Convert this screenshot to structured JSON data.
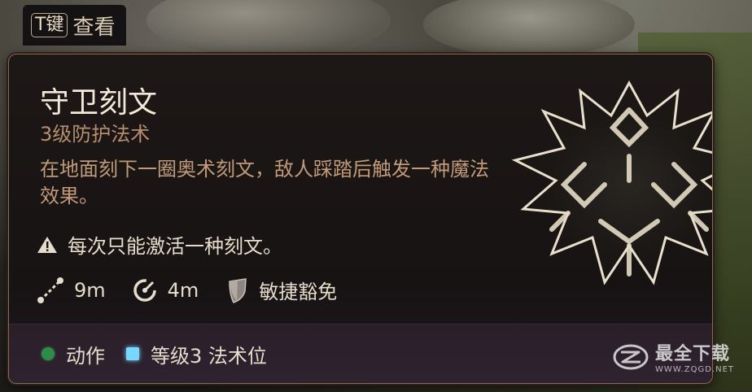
{
  "hotkey": {
    "key": "T键",
    "label": "查看"
  },
  "spell": {
    "name": "守卫刻文",
    "level_school": "3级防护法术",
    "description": "在地面刻下一圈奥术刻文，敌人踩踏后触发一种魔法效果。",
    "note": "每次只能激活一种刻文。",
    "stats": {
      "range": "9m",
      "area": "4m",
      "save": "敏捷豁免"
    },
    "cost": {
      "action": "动作",
      "spell_slot": "等级3 法术位"
    }
  },
  "icons": {
    "note": "warning-triangle-icon",
    "range": "range-ruler-icon",
    "area": "radius-icon",
    "save": "shield-icon",
    "action": "action-dot-icon",
    "spell_slot": "spell-slot-square-icon"
  },
  "colors": {
    "title": "#f3e9da",
    "subtitle": "#b68e6d",
    "description": "#c29a7a",
    "border": "#8c6a52",
    "action_dot": "#2e8b49",
    "spell_slot": "#79d6ff"
  },
  "watermark": {
    "main": "最全下载",
    "sub": "WWW.ZQGD.NET"
  }
}
